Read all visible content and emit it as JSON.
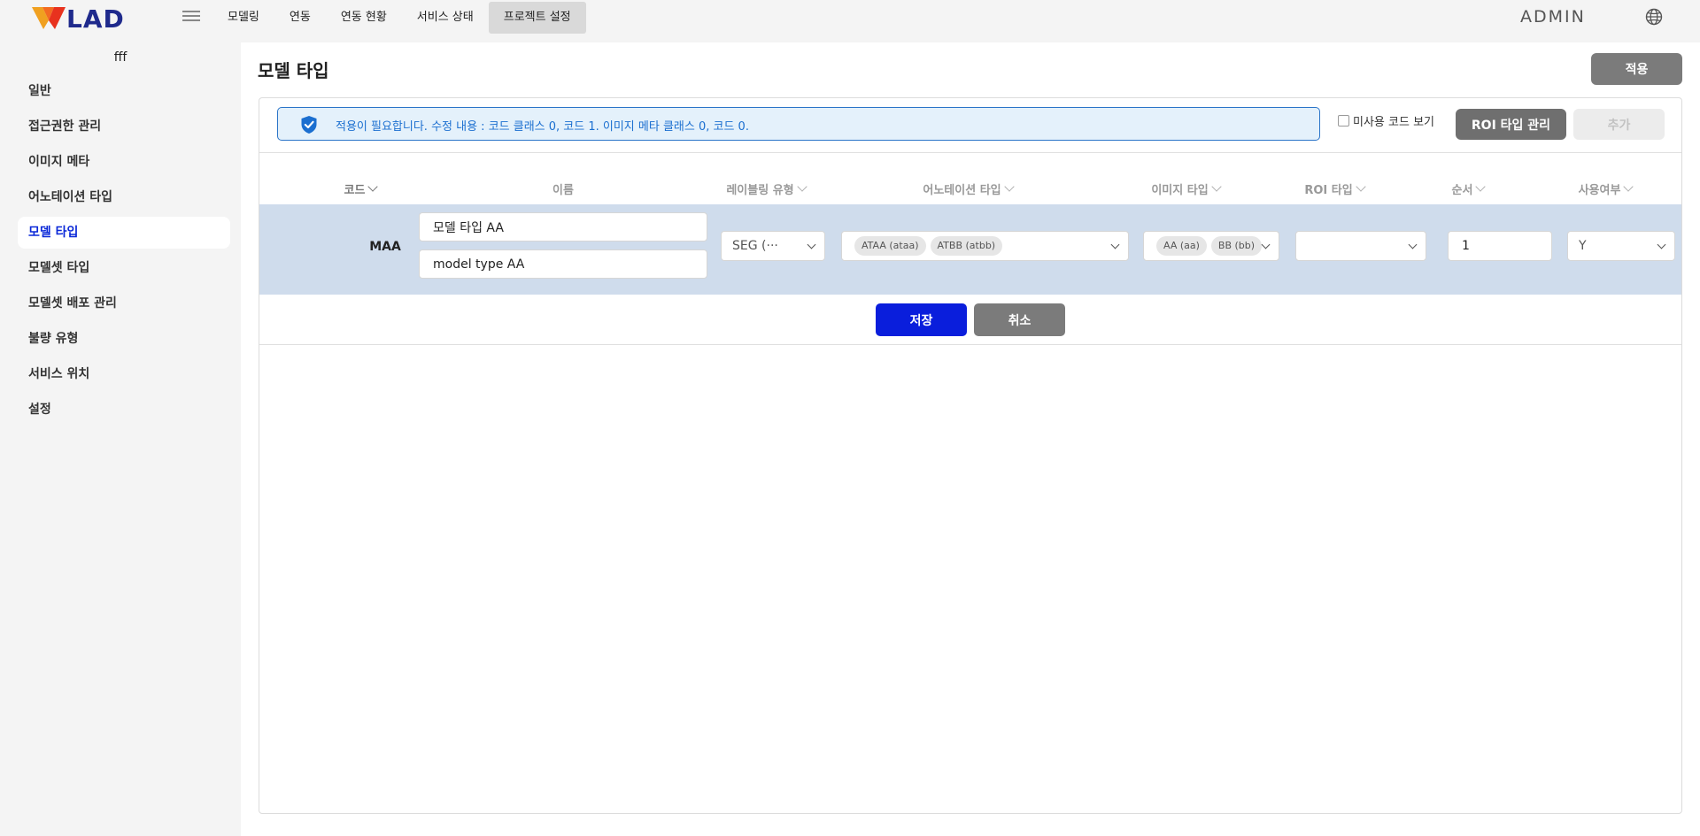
{
  "brand": {
    "logo_text": "VLAD",
    "accent_colors": [
      "#f0a020",
      "#e8321e",
      "#1f2a8c"
    ]
  },
  "nav": {
    "items": [
      {
        "label": "모델링",
        "active": false
      },
      {
        "label": "연동",
        "active": false
      },
      {
        "label": "연동 현황",
        "active": false
      },
      {
        "label": "서비스 상태",
        "active": false
      },
      {
        "label": "프로젝트 설정",
        "active": true
      }
    ],
    "menu_icon": "hamburger-icon",
    "globe_icon": "globe-icon"
  },
  "user": {
    "name": "ADMIN"
  },
  "sidebar": {
    "project_name": "fff",
    "items": [
      {
        "label": "일반",
        "active": false
      },
      {
        "label": "접근권한 관리",
        "active": false
      },
      {
        "label": "이미지 메타",
        "active": false
      },
      {
        "label": "어노테이션 타입",
        "active": false
      },
      {
        "label": "모델 타입",
        "active": true
      },
      {
        "label": "모델셋 타입",
        "active": false
      },
      {
        "label": "모델셋 배포 관리",
        "active": false
      },
      {
        "label": "불량 유형",
        "active": false
      },
      {
        "label": "서비스 위치",
        "active": false
      },
      {
        "label": "설정",
        "active": false
      }
    ]
  },
  "page": {
    "title": "모델 타입",
    "apply_label": "적용",
    "notice": {
      "icon": "shield-check-icon",
      "text": "적용이 필요합니다. 수정 내용 : 코드 클래스 0, 코드 1. 이미지 메타 클래스 0, 코드 0."
    },
    "show_unused_label": "미사용 코드 보기",
    "show_unused_checked": false,
    "roi_manage_label": "ROI 타입 관리",
    "add_label": "추가"
  },
  "table": {
    "columns": [
      {
        "label": "코드"
      },
      {
        "label": "이름"
      },
      {
        "label": "레이블링 유형"
      },
      {
        "label": "어노테이션 타입"
      },
      {
        "label": "이미지 타입"
      },
      {
        "label": "ROI 타입"
      },
      {
        "label": "순서"
      },
      {
        "label": "사용여부"
      }
    ],
    "edit_row": {
      "code": "MAA",
      "name_ko": "모델 타입 AA",
      "name_en": "model type AA",
      "labeling_type": "SEG (···",
      "annotation_tags": [
        "ATAA (ataa)",
        "ATBB (atbb)"
      ],
      "image_tags": [
        "AA (aa)",
        "BB (bb)"
      ],
      "roi_type": "",
      "order": "1",
      "use_yn": "Y"
    },
    "save_label": "저장",
    "cancel_label": "취소"
  }
}
